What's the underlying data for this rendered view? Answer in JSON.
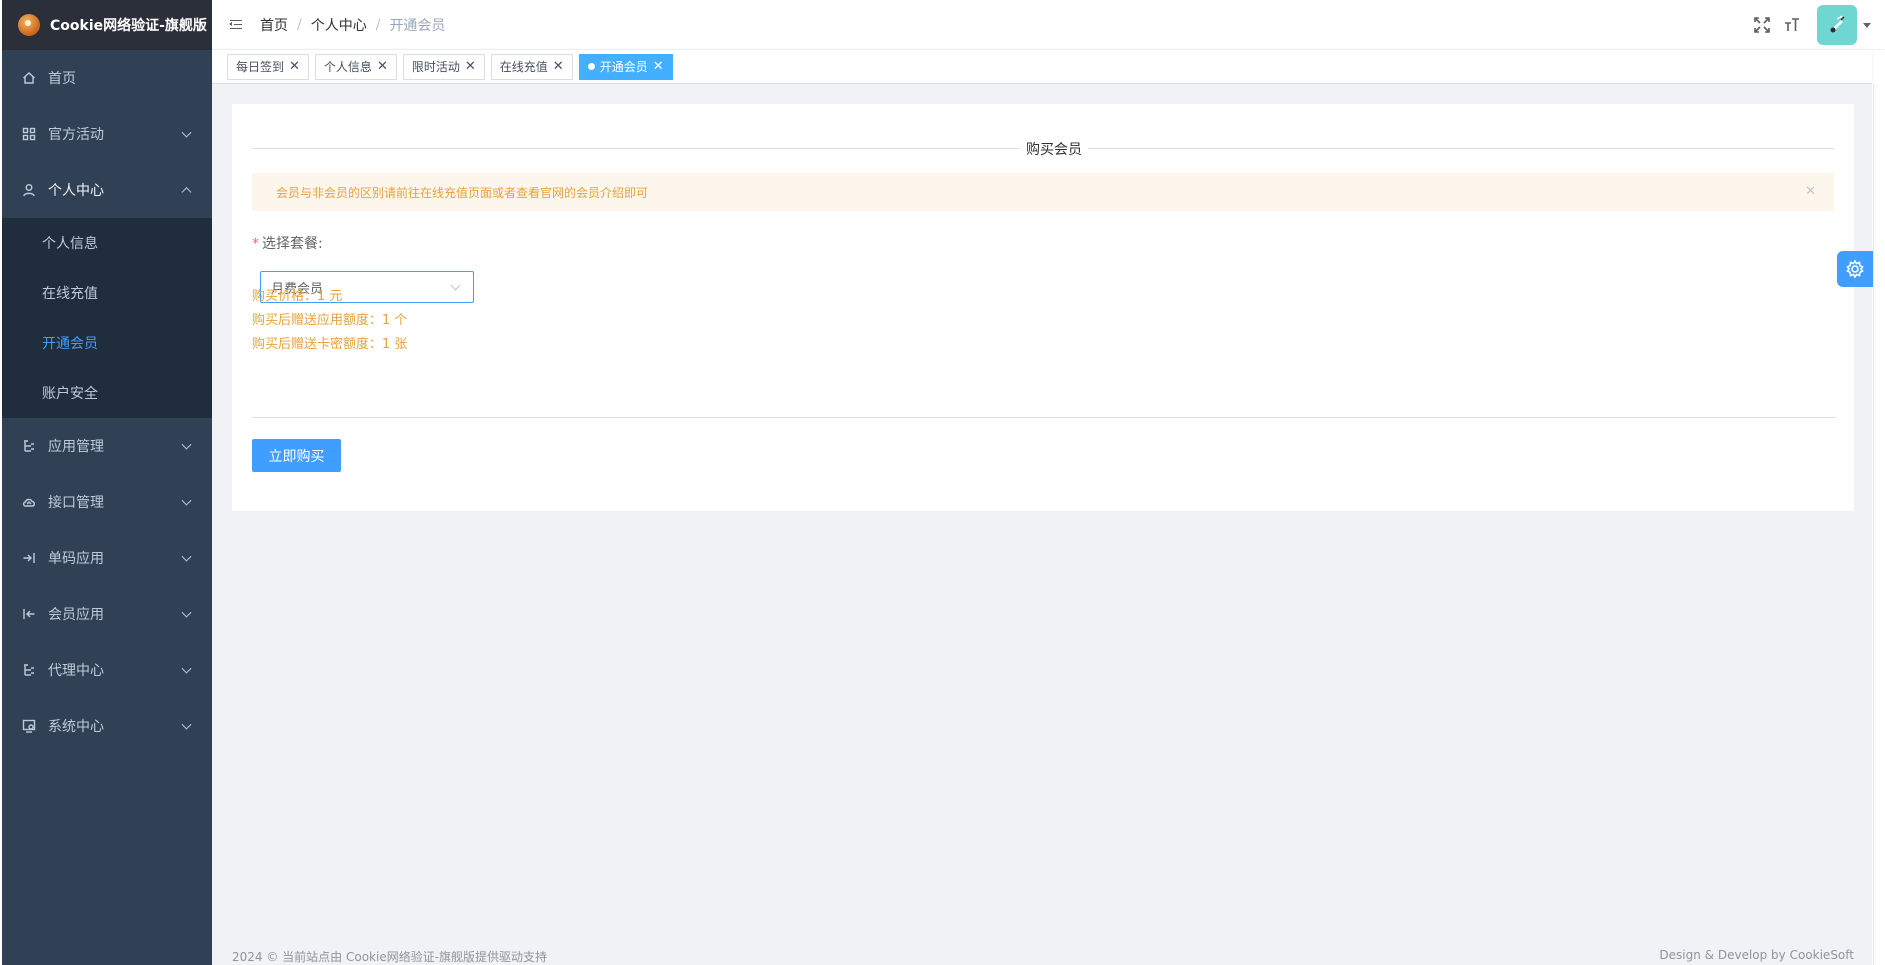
{
  "app": {
    "title": "Cookie网络验证-旗舰版"
  },
  "sidebar": {
    "items": [
      {
        "label": "首页",
        "icon": "home-icon"
      },
      {
        "label": "官方活动",
        "icon": "grid-icon"
      },
      {
        "label": "个人中心",
        "icon": "user-icon"
      },
      {
        "label": "应用管理",
        "icon": "tree-icon"
      },
      {
        "label": "接口管理",
        "icon": "cloud-icon"
      },
      {
        "label": "单码应用",
        "icon": "login-icon"
      },
      {
        "label": "会员应用",
        "icon": "logout-icon"
      },
      {
        "label": "代理中心",
        "icon": "tree-icon"
      },
      {
        "label": "系统中心",
        "icon": "monitor-icon"
      }
    ],
    "submenu": [
      {
        "label": "个人信息"
      },
      {
        "label": "在线充值"
      },
      {
        "label": "开通会员"
      },
      {
        "label": "账户安全"
      }
    ]
  },
  "breadcrumb": [
    "首页",
    "个人中心",
    "开通会员"
  ],
  "tags": [
    "每日签到",
    "个人信息",
    "限时活动",
    "在线充值",
    "开通会员"
  ],
  "page": {
    "section_title": "购买会员",
    "alert": "会员与非会员的区别请前往在线充值页面或者查看官网的会员介绍即可",
    "form_label": "选择套餐:",
    "required_mark": "*",
    "select_value": "月费会员",
    "price": "购买价格：1 元",
    "app_quota": "购买后赠送应用额度：1 个",
    "card_quota": "购买后赠送卡密额度：1 张",
    "buy_button": "立即购买"
  },
  "footer": {
    "left": "2024 © 当前站点由 Cookie网络验证-旗舰版提供驱动支持",
    "right": "Design & Develop by CookieSoft"
  },
  "colors": {
    "accent": "#409eff",
    "sidebar_bg": "#304156",
    "warning": "#e6a23c"
  }
}
